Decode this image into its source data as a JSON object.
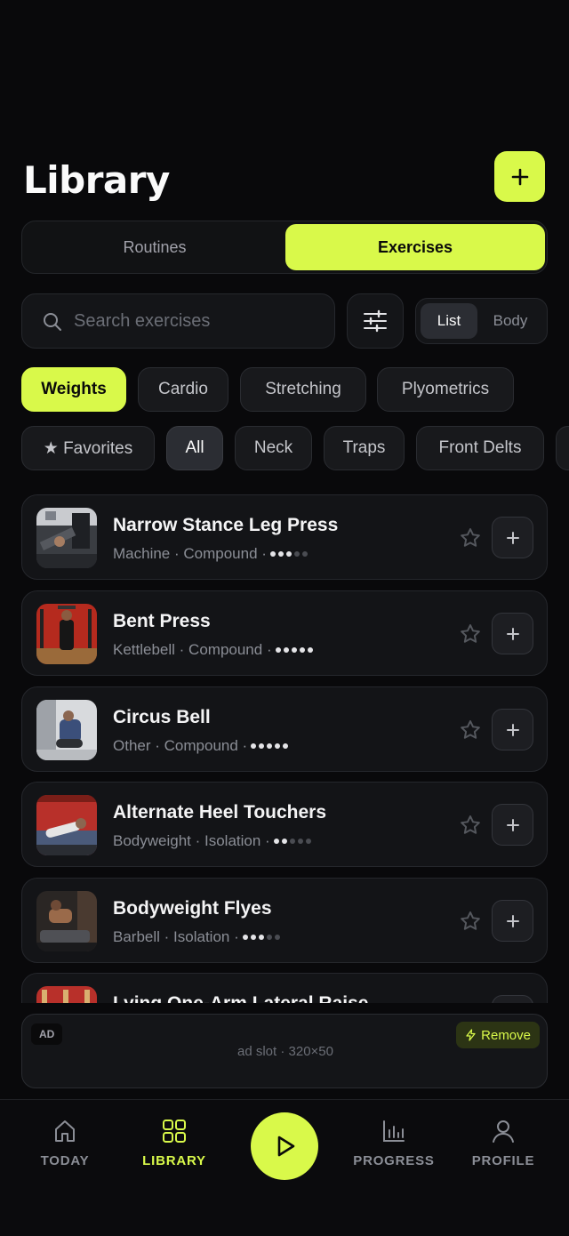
{
  "header": {
    "title": "Library"
  },
  "segments": [
    {
      "label": "Routines",
      "active": false
    },
    {
      "label": "Exercises",
      "active": true
    }
  ],
  "search": {
    "placeholder": "Search exercises",
    "value": ""
  },
  "view_toggle": {
    "list": "List",
    "body": "Body",
    "selected": "List"
  },
  "type_filters": [
    "Weights",
    "Cardio",
    "Stretching",
    "Plyometrics"
  ],
  "type_selected": "Weights",
  "muscle_filters": [
    "★ Favorites",
    "All",
    "Neck",
    "Traps",
    "Front Delts"
  ],
  "muscle_selected": "All",
  "exercises": [
    {
      "name": "Narrow Stance Leg Press",
      "equipment": "Machine",
      "mechanic": "Compound",
      "difficulty": 3
    },
    {
      "name": "Bent Press",
      "equipment": "Kettlebell",
      "mechanic": "Compound",
      "difficulty": 5
    },
    {
      "name": "Circus Bell",
      "equipment": "Other",
      "mechanic": "Compound",
      "difficulty": 5
    },
    {
      "name": "Alternate Heel Touchers",
      "equipment": "Bodyweight",
      "mechanic": "Isolation",
      "difficulty": 2
    },
    {
      "name": "Bodyweight Flyes",
      "equipment": "Barbell",
      "mechanic": "Isolation",
      "difficulty": 3
    },
    {
      "name": "Lying One-Arm Lateral Raise",
      "equipment": "",
      "mechanic": "",
      "difficulty": 0
    }
  ],
  "ad": {
    "badge": "AD",
    "remove_label": "Remove",
    "slot_text": "ad slot · 320×50"
  },
  "nav": {
    "today": "TODAY",
    "library": "LIBRARY",
    "progress": "PROGRESS",
    "profile": "PROFILE",
    "active": "LIBRARY"
  },
  "colors": {
    "accent": "#d9f94a",
    "background": "#09090b",
    "card": "#131417"
  },
  "icons": [
    "plus-icon",
    "search-icon",
    "sliders-icon",
    "star-icon",
    "play-icon",
    "home-icon",
    "grid-icon",
    "chart-icon",
    "user-icon",
    "bolt-icon"
  ]
}
